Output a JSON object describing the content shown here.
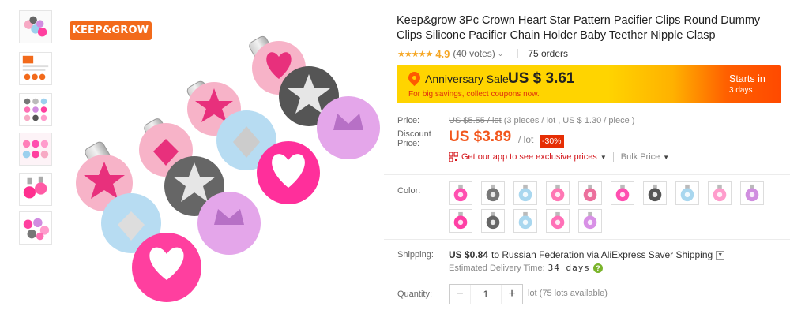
{
  "gallery": {
    "thumbnails": [
      {
        "name": "thumb-pacifier-clips-set"
      },
      {
        "name": "thumb-size-chart"
      },
      {
        "name": "thumb-color-chart"
      },
      {
        "name": "thumb-pink-clips"
      },
      {
        "name": "thumb-rose-clips"
      },
      {
        "name": "thumb-pink-assortment"
      }
    ],
    "brand_logo": "KEEP&GROW"
  },
  "product": {
    "title": "Keep&grow 3Pc Crown Heart Star Pattern Pacifier Clips Round Dummy Clips Silicone Pacifier Chain Holder Baby Teether Nipple Clasp",
    "stars": "★★★★★",
    "rating": "4.9",
    "votes": "(40 votes)",
    "orders": "75 orders"
  },
  "sale": {
    "name": "Anniversary Sale",
    "price": "US $ 3.61",
    "subtitle": "For big savings, collect coupons now.",
    "starts_in": "Starts in",
    "starts_days": "3 days"
  },
  "pricing": {
    "price_label": "Price:",
    "original_price": "US $5.55 / lot",
    "original_note": "(3 pieces / lot , US $ 1.30 / piece )",
    "discount_label_1": "Discount",
    "discount_label_2": "Price:",
    "discount_price": "US $3.89",
    "per_lot": "/ lot",
    "discount_badge": "-30%",
    "app_deal": "Get our app to see exclusive prices",
    "bulk_price": "Bulk Price"
  },
  "options": {
    "color_label": "Color:",
    "swatches_row1": [
      "#ff4fb0",
      "#777777",
      "#a9d7ef",
      "#ff77b4",
      "#ec6f9c",
      "#ff4fb0",
      "#555555",
      "#a9d7ef",
      "#ff9ccc",
      "#d08ee0"
    ],
    "swatches_row2": [
      "#ff3fa5",
      "#666666",
      "#a9d7ef",
      "#ff70b7",
      "#d890e6"
    ]
  },
  "shipping": {
    "label": "Shipping:",
    "cost": "US $0.84",
    "destination": "to Russian Federation via AliExpress Saver Shipping",
    "delivery_label": "Estimated Delivery Time:",
    "delivery_days": "34 days"
  },
  "quantity": {
    "label": "Quantity:",
    "minus": "−",
    "value": "1",
    "plus": "+",
    "note": "lot (75 lots available)"
  }
}
